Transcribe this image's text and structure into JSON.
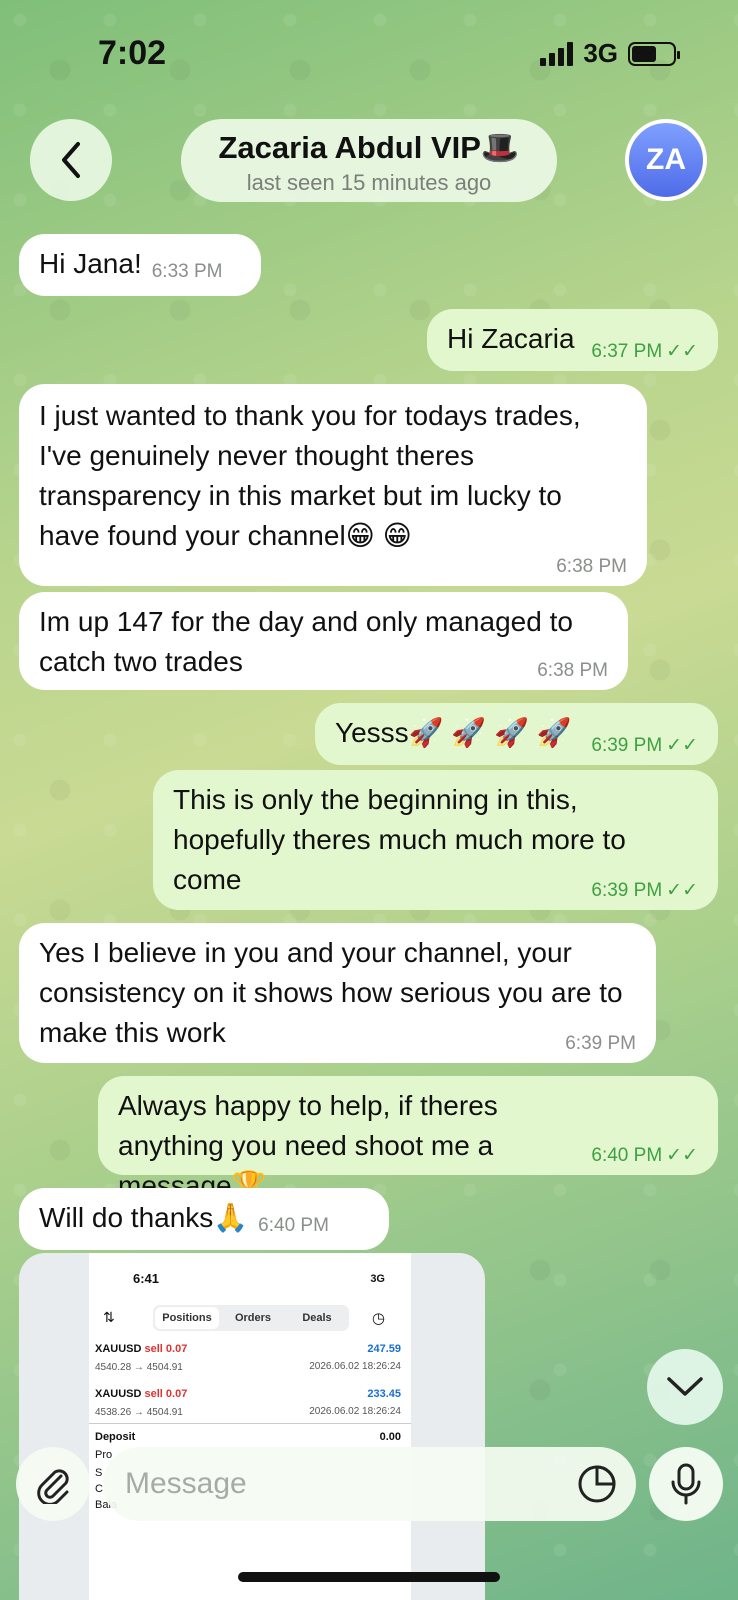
{
  "status": {
    "time": "7:02",
    "network": "3G"
  },
  "header": {
    "name": "Zacaria Abdul VIP🎩",
    "last_seen": "last seen 15 minutes ago",
    "avatar_initials": "ZA"
  },
  "messages": [
    {
      "dir": "in",
      "text": "Hi Jana!",
      "time": "6:33 PM"
    },
    {
      "dir": "out",
      "text": "Hi Zacaria",
      "time": "6:37 PM"
    },
    {
      "dir": "in",
      "text": "I just wanted to thank you for todays trades, I've genuinely never thought theres transparency in this market but im lucky to have found your channel😁 😁",
      "time": "6:38 PM"
    },
    {
      "dir": "in",
      "text": "Im up 147 for the day and only managed to catch two trades",
      "time": "6:38 PM"
    },
    {
      "dir": "out",
      "text": "Yesss🚀 🚀 🚀 🚀",
      "time": "6:39 PM"
    },
    {
      "dir": "out",
      "text": "This is only the beginning in this, hopefully theres much much more to come",
      "time": "6:39 PM"
    },
    {
      "dir": "in",
      "text": "Yes I believe in you and your channel, your consistency on it shows how serious you are to make this work",
      "time": "6:39 PM"
    },
    {
      "dir": "out",
      "text": "Always happy to help, if theres anything you need shoot me a message🏆",
      "time": "6:40 PM"
    },
    {
      "dir": "in",
      "text": "Will do thanks🙏",
      "time": "6:40 PM"
    }
  ],
  "screenshot": {
    "time": "6:41",
    "status": "3G",
    "tabs": [
      "Positions",
      "Orders",
      "Deals"
    ],
    "positions": [
      {
        "symbol": "XAUUSD",
        "side": "sell 0.07",
        "prices": "4540.28 → 4504.91",
        "profit": "247.59",
        "date": "2026.06.02 18:26:24"
      },
      {
        "symbol": "XAUUSD",
        "side": "sell 0.07",
        "prices": "4538.26 → 4504.91",
        "profit": "233.45",
        "date": "2026.06.02 18:26:24"
      }
    ],
    "deposit_label": "Deposit",
    "deposit_value": "0.00",
    "partial_rows": [
      "Pro",
      "S",
      "C",
      "Bala"
    ]
  },
  "composer": {
    "placeholder": "Message"
  },
  "colors": {
    "incoming": "#ffffff",
    "outgoing": "#e3f7cf",
    "accent": "#3ea040"
  }
}
